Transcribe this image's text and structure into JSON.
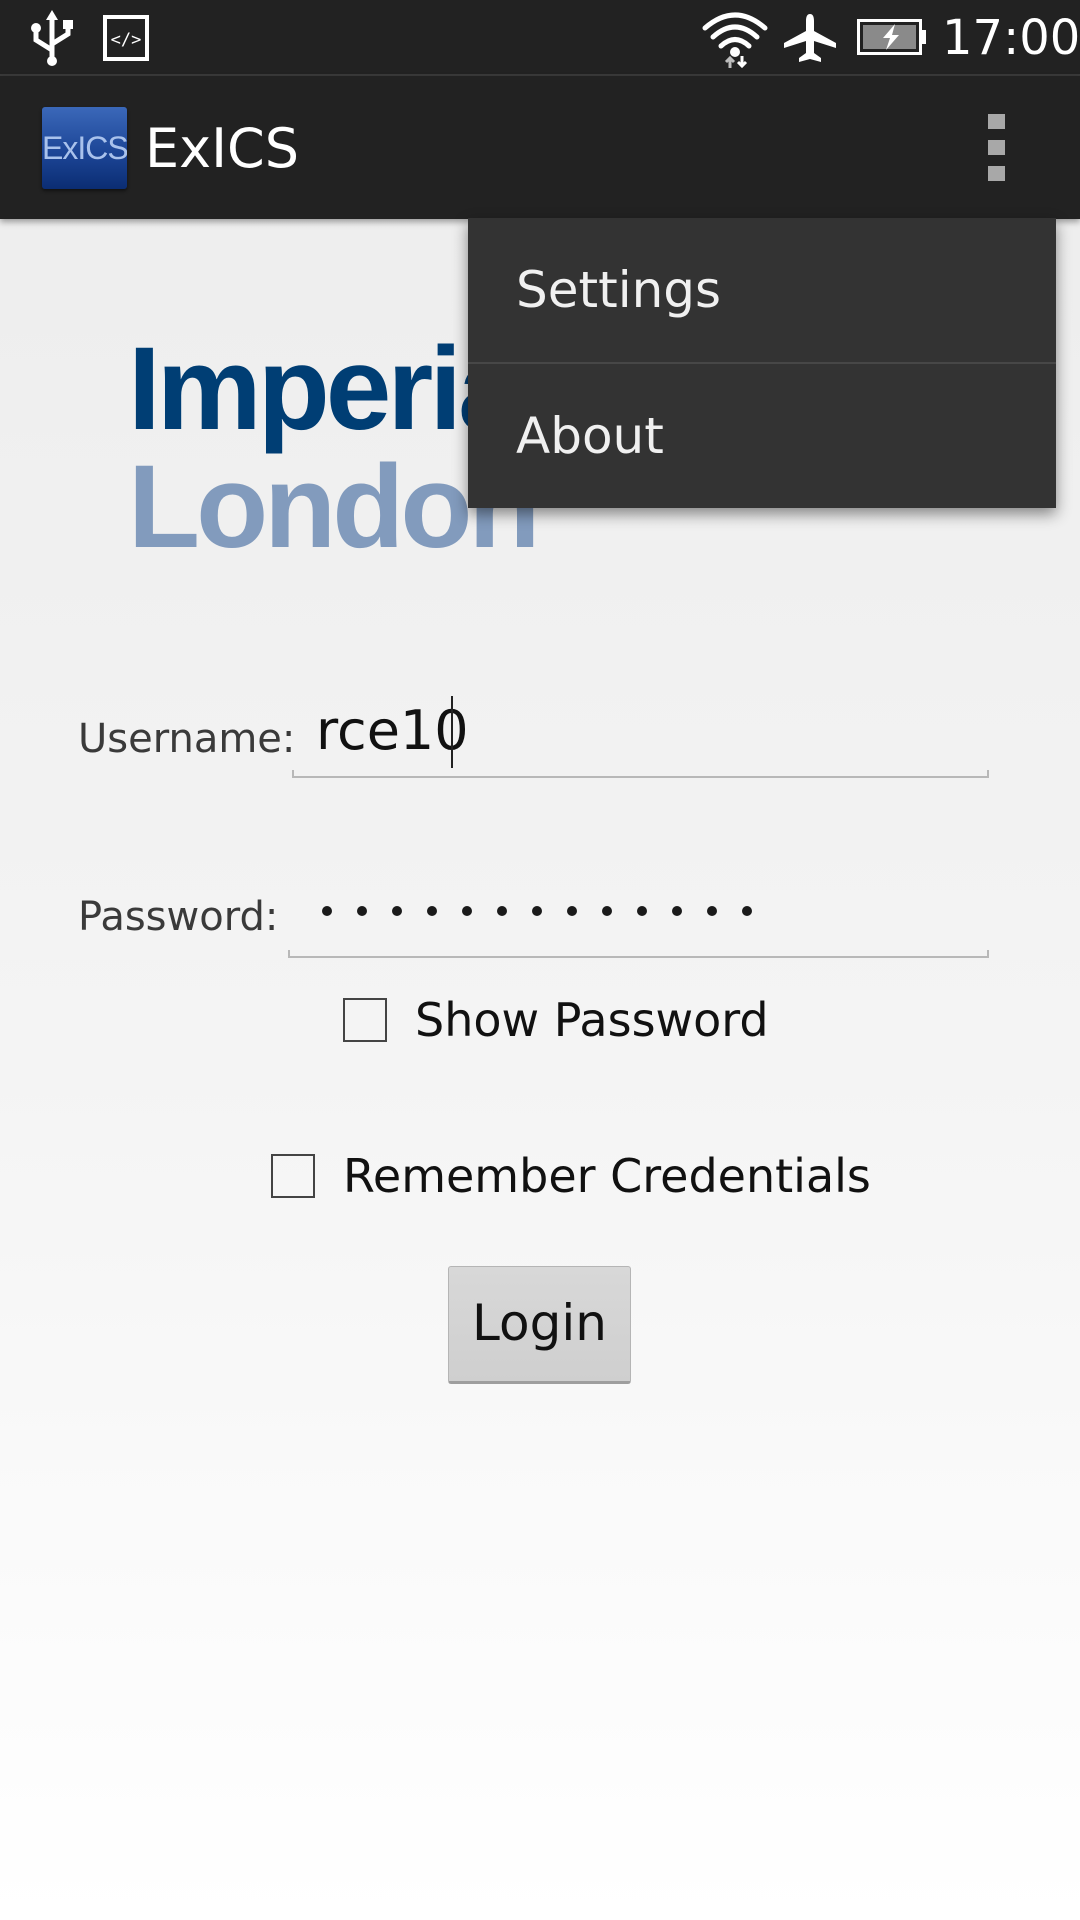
{
  "status_bar": {
    "time": "17:00",
    "icons": [
      "usb-icon",
      "developer-mode-icon",
      "wifi-icon",
      "airplane-mode-icon",
      "battery-charging-icon"
    ]
  },
  "action_bar": {
    "app_icon_text": "ExICS",
    "title": "ExICS",
    "overflow_icon": "overflow-menu-icon"
  },
  "logo": {
    "line1": "Imperial",
    "line2": "London",
    "colors": {
      "line1": "#003e74",
      "line2": "#829bbd"
    }
  },
  "menu": {
    "items": [
      {
        "label": "Settings"
      },
      {
        "label": "About"
      }
    ]
  },
  "form": {
    "username_label": "Username:",
    "username_value": "rce10",
    "password_label": "Password:",
    "password_mask_length": 13,
    "show_password_label": "Show Password",
    "show_password_checked": false,
    "remember_label": "Remember Credentials",
    "remember_checked": false,
    "login_label": "Login"
  },
  "colors": {
    "bar_background": "#222222",
    "menu_background": "#333333"
  }
}
